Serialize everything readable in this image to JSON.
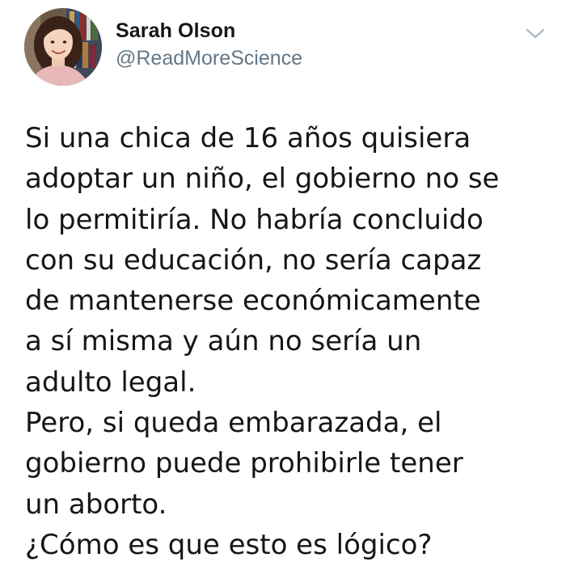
{
  "author": {
    "display_name": "Sarah Olson",
    "handle": "@ReadMoreScience",
    "avatar_icon": "profile-photo-avatar"
  },
  "menu": {
    "icon": "chevron-down-icon",
    "color": "#aab8c2"
  },
  "tweet": {
    "lines": [
      "Si una chica de 16 años quisiera",
      "adoptar un niño, el gobierno no se",
      "lo permitiría. No habría concluido",
      "con su educación, no sería capaz",
      "de mantenerse económicamente",
      "a sí misma y aún no sería un",
      "adulto legal.",
      "Pero, si queda embarazada, el",
      "gobierno puede prohibirle tener",
      "un aborto.",
      "¿Cómo es que esto es lógico?"
    ]
  },
  "colors": {
    "text": "#14171a",
    "handle": "#657786",
    "background": "#ffffff"
  }
}
